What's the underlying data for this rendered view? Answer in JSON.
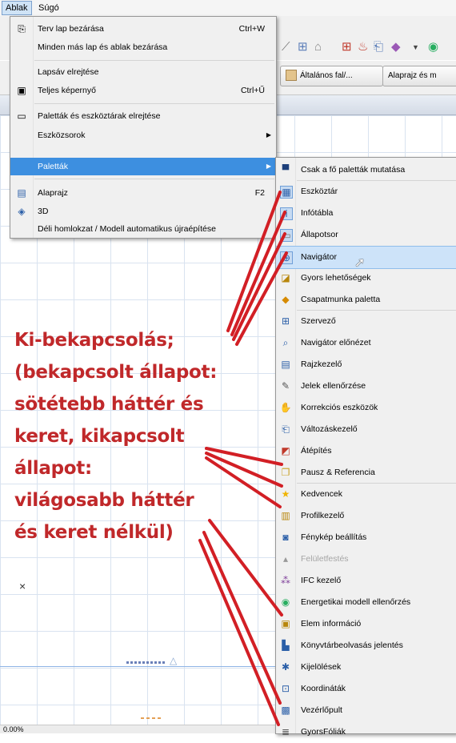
{
  "menubar": {
    "items": [
      "Ablak",
      "Súgó"
    ]
  },
  "infobox": {
    "wall_button": "Általános fal/...",
    "plan_button": "Alaprajz és m"
  },
  "window_menu": {
    "items": [
      {
        "label": "Terv lap bezárása",
        "shortcut": "Ctrl+W",
        "icon": "close-sheet-icon"
      },
      {
        "label": "Minden más lap és ablak bezárása",
        "shortcut": "",
        "icon": ""
      },
      {
        "label": "Lapsáv elrejtése",
        "shortcut": "",
        "icon": ""
      },
      {
        "label": "Teljes képernyő",
        "shortcut": "Ctrl+Ű",
        "icon": "fullscreen-icon"
      },
      {
        "label": "Paletták és eszköztárak elrejtése",
        "shortcut": "",
        "icon": "monitor-icon"
      },
      {
        "label": "Eszközsorok",
        "shortcut": "",
        "icon": ""
      },
      {
        "label": "Paletták",
        "shortcut": "",
        "icon": ""
      },
      {
        "label": "Alaprajz",
        "shortcut": "F2",
        "icon": "floor-plan-icon"
      },
      {
        "label": "3D",
        "shortcut": "",
        "icon": "3d-window-icon"
      },
      {
        "label": "Déli homlokzat / Modell automatikus újraépítése",
        "shortcut": "",
        "icon": ""
      }
    ]
  },
  "palettes_menu": {
    "items": [
      {
        "label": "Csak a fő paletták mutatása",
        "icon": "main-palettes-icon",
        "glyph": "▀",
        "on": false,
        "disabled": false
      },
      {
        "label": "Eszköztár",
        "icon": "toolbox-icon",
        "glyph": "▦",
        "on": true,
        "disabled": false
      },
      {
        "label": "Infótábla",
        "icon": "info-box-icon",
        "glyph": "ⅰ",
        "on": true,
        "disabled": false
      },
      {
        "label": "Állapotsor",
        "icon": "status-bar-icon",
        "glyph": "▭",
        "on": true,
        "disabled": false
      },
      {
        "label": "Navigátor",
        "icon": "navigator-icon",
        "glyph": "⊕",
        "on": true,
        "disabled": false
      },
      {
        "label": "Gyors lehetőségek",
        "icon": "quick-options-icon",
        "glyph": "◪",
        "on": false,
        "disabled": false
      },
      {
        "label": "Csapatmunka paletta",
        "icon": "teamwork-icon",
        "glyph": "◆",
        "on": false,
        "disabled": false
      },
      {
        "label": "Szervező",
        "icon": "organizer-icon",
        "glyph": "⊞",
        "on": false,
        "disabled": false
      },
      {
        "label": "Navigátor előnézet",
        "icon": "navigator-preview-icon",
        "glyph": "⌕",
        "on": false,
        "disabled": false
      },
      {
        "label": "Rajzkezelő",
        "icon": "drawing-manager-icon",
        "glyph": "▤",
        "on": false,
        "disabled": false
      },
      {
        "label": "Jelek ellenőrzése",
        "icon": "check-marks-icon",
        "glyph": "✎",
        "on": false,
        "disabled": false
      },
      {
        "label": "Korrekciós eszközök",
        "icon": "correction-tools-icon",
        "glyph": "✋",
        "on": false,
        "disabled": false
      },
      {
        "label": "Változáskezelő",
        "icon": "change-manager-icon",
        "glyph": "⎗",
        "on": false,
        "disabled": false
      },
      {
        "label": "Átépítés",
        "icon": "renovation-icon",
        "glyph": "◩",
        "on": false,
        "disabled": false
      },
      {
        "label": "Pausz & Referencia",
        "icon": "trace-reference-icon",
        "glyph": "❐",
        "on": false,
        "disabled": false
      },
      {
        "label": "Kedvencek",
        "icon": "favorites-star-icon",
        "glyph": "★",
        "on": false,
        "disabled": false
      },
      {
        "label": "Profilkezelő",
        "icon": "profile-manager-icon",
        "glyph": "▥",
        "on": false,
        "disabled": false
      },
      {
        "label": "Fénykép beállítás",
        "icon": "photo-settings-icon",
        "glyph": "◙",
        "on": false,
        "disabled": false
      },
      {
        "label": "Felületfestés",
        "icon": "surface-painter-icon",
        "glyph": "▴",
        "on": false,
        "disabled": true
      },
      {
        "label": "IFC kezelő",
        "icon": "ifc-manager-icon",
        "glyph": "⁂",
        "on": false,
        "disabled": false
      },
      {
        "label": "Energetikai modell ellenőrzés",
        "icon": "energy-check-icon",
        "glyph": "◉",
        "on": false,
        "disabled": false
      },
      {
        "label": "Elem információ",
        "icon": "element-info-icon",
        "glyph": "▣",
        "on": false,
        "disabled": false
      },
      {
        "label": "Könyvtárbeolvasás jelentés",
        "icon": "library-report-icon",
        "glyph": "▙",
        "on": false,
        "disabled": false
      },
      {
        "label": "Kijelölések",
        "icon": "selections-icon",
        "glyph": "✱",
        "on": false,
        "disabled": false
      },
      {
        "label": "Koordináták",
        "icon": "coordinates-icon",
        "glyph": "⊡",
        "on": false,
        "disabled": false
      },
      {
        "label": "Vezérlőpult",
        "icon": "control-box-icon",
        "glyph": "▩",
        "on": false,
        "disabled": false
      },
      {
        "label": "GyorsFóliák",
        "icon": "quick-layers-icon",
        "glyph": "≣",
        "on": false,
        "disabled": false
      }
    ]
  },
  "annotation": {
    "lines": [
      "Ki-bekapcsolás;",
      "(bekapcsolt állapot:",
      "sötétebb háttér és",
      "keret, kikapcsolt",
      "állapot:",
      "világosabb háttér",
      "és keret nélkül)"
    ],
    "color": "#c0282a"
  },
  "statusbar": {
    "zoom": "0.00%"
  }
}
